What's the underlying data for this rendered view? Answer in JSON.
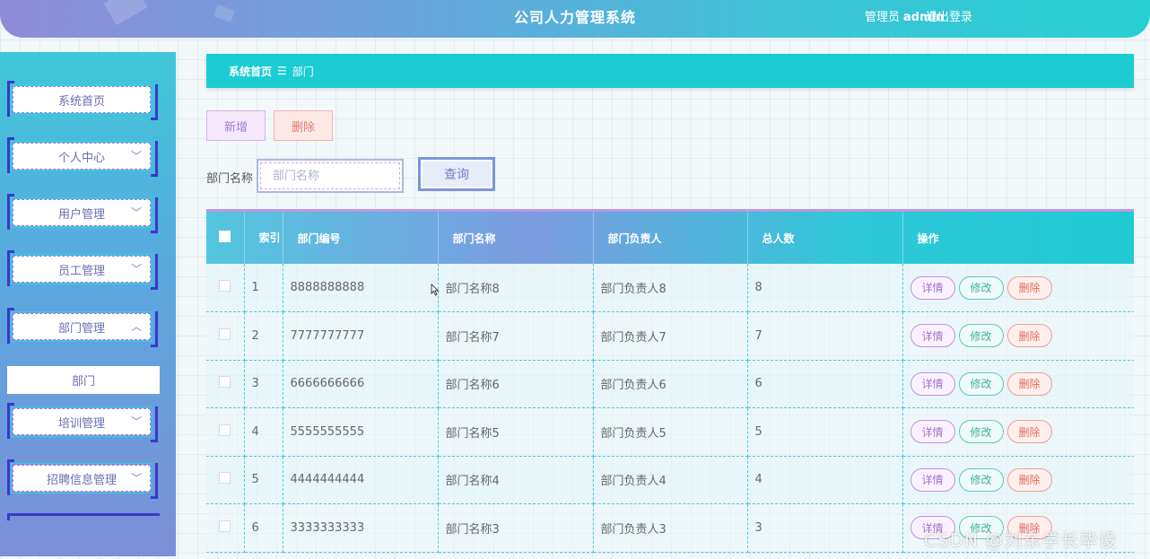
{
  "header": {
    "title": "公司人力管理系统",
    "user_role": "管理员",
    "user_name": "admin",
    "logout": "退出登录"
  },
  "sidebar": {
    "items": [
      {
        "label": "系统首页",
        "chevron": ""
      },
      {
        "label": "个人中心",
        "chevron": "﹀"
      },
      {
        "label": "用户管理",
        "chevron": "﹀"
      },
      {
        "label": "员工管理",
        "chevron": "﹀"
      },
      {
        "label": "部门管理",
        "chevron": "︿"
      },
      {
        "label": "培训管理",
        "chevron": "﹀"
      },
      {
        "label": "招聘信息管理",
        "chevron": "﹀"
      }
    ],
    "sub_item": "部门"
  },
  "breadcrumb": {
    "home": "系统首页",
    "separator": "☰",
    "current": "部门"
  },
  "actions": {
    "add": "新增",
    "delete": "删除"
  },
  "search": {
    "label": "部门名称",
    "placeholder": "部门名称",
    "button": "查询"
  },
  "table": {
    "headers": {
      "index": "索引",
      "code": "部门编号",
      "name": "部门名称",
      "manager": "部门负责人",
      "count": "总人数",
      "ops": "操作"
    },
    "rows": [
      {
        "index": "1",
        "code": "8888888888",
        "name": "部门名称8",
        "manager": "部门负责人8",
        "count": "8"
      },
      {
        "index": "2",
        "code": "7777777777",
        "name": "部门名称7",
        "manager": "部门负责人7",
        "count": "7"
      },
      {
        "index": "3",
        "code": "6666666666",
        "name": "部门名称6",
        "manager": "部门负责人6",
        "count": "6"
      },
      {
        "index": "4",
        "code": "5555555555",
        "name": "部门名称5",
        "manager": "部门负责人5",
        "count": "5"
      },
      {
        "index": "5",
        "code": "4444444444",
        "name": "部门名称4",
        "manager": "部门负责人4",
        "count": "4"
      },
      {
        "index": "6",
        "code": "3333333333",
        "name": "部门名称3",
        "manager": "部门负责人3",
        "count": "3"
      }
    ],
    "ops": {
      "detail": "详情",
      "edit": "修改",
      "delete": "删除"
    }
  },
  "watermark": "CSDN @刘东学长毕设",
  "colors": {
    "accent": "#1bccd3",
    "brand_purple": "#7d8fd9",
    "detail": "#a66fd0",
    "edit": "#3fb29f",
    "delete": "#e06b60"
  },
  "icons": [
    "chevron-down-icon",
    "chevron-up-icon",
    "menu-icon",
    "checkbox-icon",
    "mouse-cursor-icon"
  ]
}
